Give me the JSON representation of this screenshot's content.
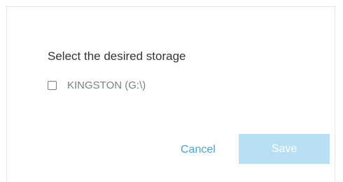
{
  "dialog": {
    "heading": "Select the desired storage",
    "options": [
      {
        "label": "KINGSTON (G:\\)",
        "checked": false
      }
    ],
    "cancel_label": "Cancel",
    "save_label": "Save",
    "save_disabled": true
  },
  "colors": {
    "accent": "#4aa3dc",
    "save_disabled_bg": "#b9dff5",
    "heading_text": "#333333",
    "option_text": "#7a7f86"
  }
}
